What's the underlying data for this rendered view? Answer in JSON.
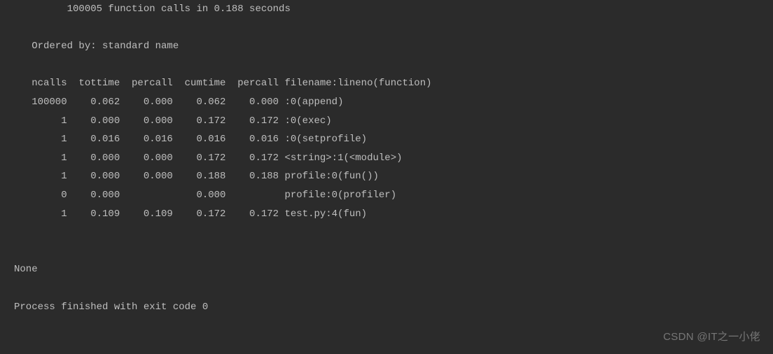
{
  "output": {
    "summary_line": "         100005 function calls in 0.188 seconds",
    "ordered_by": "   Ordered by: standard name",
    "header": "   ncalls  tottime  percall  cumtime  percall filename:lineno(function)",
    "rows": {
      "r0": "   100000    0.062    0.000    0.062    0.000 :0(append)",
      "r1": "        1    0.000    0.000    0.172    0.172 :0(exec)",
      "r2": "        1    0.016    0.016    0.016    0.016 :0(setprofile)",
      "r3": "        1    0.000    0.000    0.172    0.172 <string>:1(<module>)",
      "r4": "        1    0.000    0.000    0.188    0.188 profile:0(fun())",
      "r5": "        0    0.000             0.000          profile:0(profiler)",
      "r6": "        1    0.109    0.109    0.172    0.172 test.py:4(fun)"
    },
    "none_line": "None",
    "process_finished": "Process finished with exit code 0"
  },
  "watermark": "CSDN @IT之一小佬"
}
